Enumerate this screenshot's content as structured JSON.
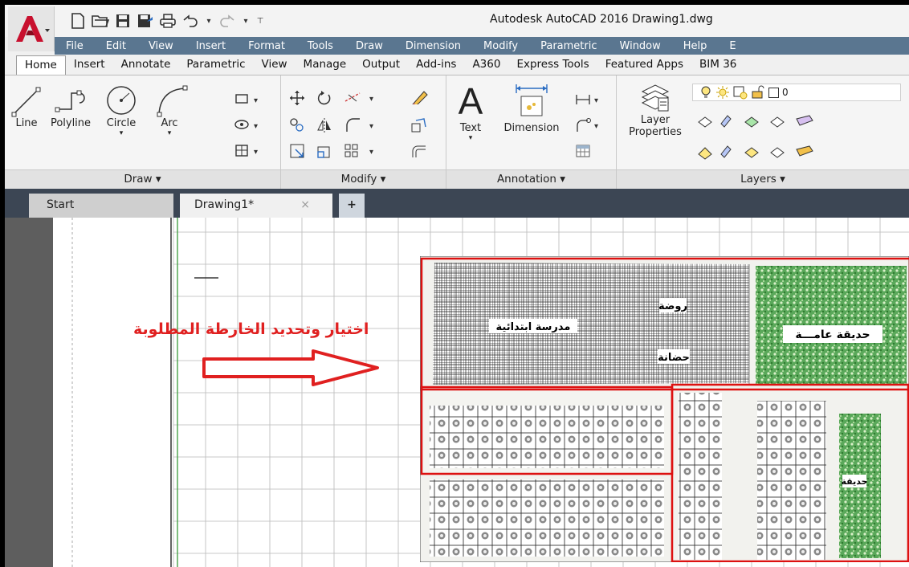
{
  "titlebar": {
    "app_title": "Autodesk AutoCAD 2016    Drawing1.dwg"
  },
  "menubar": {
    "items": [
      "File",
      "Edit",
      "View",
      "Insert",
      "Format",
      "Tools",
      "Draw",
      "Dimension",
      "Modify",
      "Parametric",
      "Window",
      "Help",
      "E"
    ]
  },
  "ribbon_tabs": {
    "items": [
      "Home",
      "Insert",
      "Annotate",
      "Parametric",
      "View",
      "Manage",
      "Output",
      "Add-ins",
      "A360",
      "Express Tools",
      "Featured Apps",
      "BIM 36"
    ],
    "active": "Home"
  },
  "draw_panel": {
    "title": "Draw ▾",
    "line": "Line",
    "polyline": "Polyline",
    "circle": "Circle",
    "arc": "Arc"
  },
  "modify_panel": {
    "title": "Modify ▾"
  },
  "annotation_panel": {
    "title": "Annotation ▾",
    "text": "Text",
    "dimension": "Dimension"
  },
  "layers_panel": {
    "title": "Layers ▾",
    "layer_properties_1": "Layer",
    "layer_properties_2": "Properties",
    "current_layer": "0"
  },
  "doc_tabs": {
    "start": "Start",
    "drawing": "Drawing1*",
    "close": "×",
    "new": "+"
  },
  "canvas": {
    "instruction": "اختيار وتحديد الخارطة المطلوبة",
    "map_labels": {
      "kindergarten": "روضة",
      "primary_school": "مدرسة ابتدائية",
      "nursery": "حضانة",
      "public_garden": "حديقة عامـــة",
      "garden": "حديقة"
    }
  },
  "colors": {
    "menubar": "#5a7690",
    "doc_tabs_bg": "#3c4654",
    "selection_red": "#e02020",
    "green_area": "#3a8a3a"
  }
}
